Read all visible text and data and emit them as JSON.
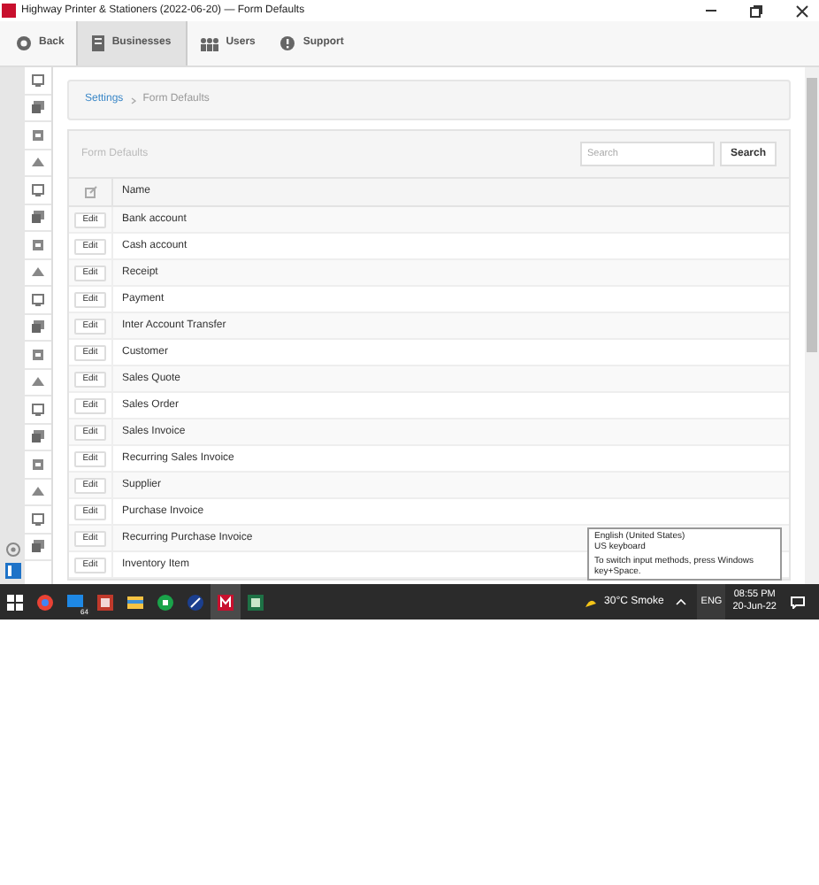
{
  "window": {
    "title": "Highway Printer & Stationers (2022-06-20) — Form Defaults"
  },
  "toolbar": [
    {
      "label": "Back",
      "selected": false
    },
    {
      "label": "Businesses",
      "selected": true
    },
    {
      "label": "Users",
      "selected": false
    },
    {
      "label": "Support",
      "selected": false
    }
  ],
  "breadcrumb": [
    "Settings",
    "Form Defaults"
  ],
  "panel": {
    "title": "Form Defaults",
    "search": {
      "placeholder": "Search"
    },
    "search_button": "Search"
  },
  "table": {
    "columns": [
      "Name"
    ],
    "rows": [
      {
        "action": "Edit",
        "name": "Bank account"
      },
      {
        "action": "Edit",
        "name": "Cash account"
      },
      {
        "action": "Edit",
        "name": "Receipt"
      },
      {
        "action": "Edit",
        "name": "Payment"
      },
      {
        "action": "Edit",
        "name": "Inter Account Transfer"
      },
      {
        "action": "Edit",
        "name": "Customer"
      },
      {
        "action": "Edit",
        "name": "Sales Quote"
      },
      {
        "action": "Edit",
        "name": "Sales Order"
      },
      {
        "action": "Edit",
        "name": "Sales Invoice"
      },
      {
        "action": "Edit",
        "name": "Recurring Sales Invoice"
      },
      {
        "action": "Edit",
        "name": "Supplier"
      },
      {
        "action": "Edit",
        "name": "Purchase Invoice"
      },
      {
        "action": "Edit",
        "name": "Recurring Purchase Invoice"
      },
      {
        "action": "Edit",
        "name": "Inventory Item"
      }
    ]
  },
  "tooltip": {
    "lines": [
      "English (United States)",
      "US keyboard",
      "To switch input methods, press Windows key+Space."
    ]
  },
  "taskbar": {
    "weather": "30°C  Smoke",
    "language": "ENG",
    "time": "08:55 PM",
    "date": "20-Jun-22",
    "badge": "64"
  }
}
